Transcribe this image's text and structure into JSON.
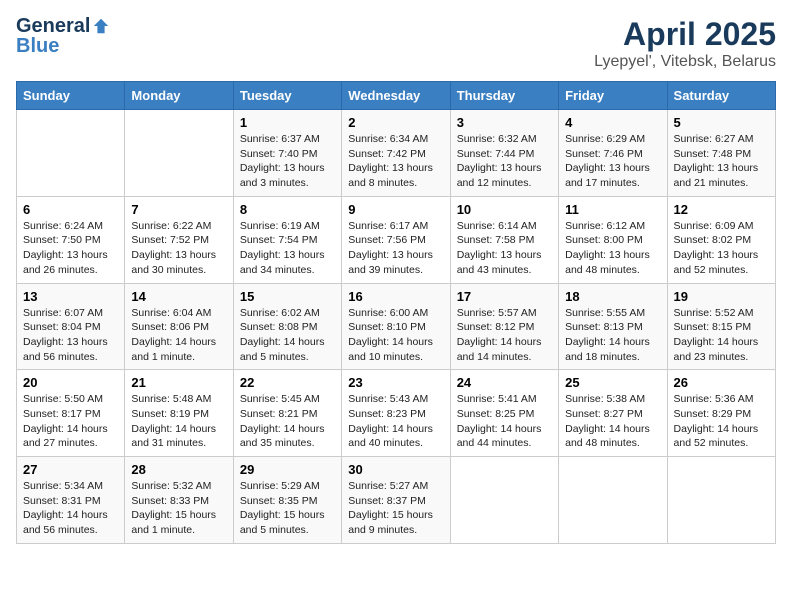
{
  "logo": {
    "general": "General",
    "blue": "Blue"
  },
  "title": "April 2025",
  "location": "Lyepyel', Vitebsk, Belarus",
  "weekdays": [
    "Sunday",
    "Monday",
    "Tuesday",
    "Wednesday",
    "Thursday",
    "Friday",
    "Saturday"
  ],
  "weeks": [
    [
      {
        "day": "",
        "info": ""
      },
      {
        "day": "",
        "info": ""
      },
      {
        "day": "1",
        "info": "Sunrise: 6:37 AM\nSunset: 7:40 PM\nDaylight: 13 hours and 3 minutes."
      },
      {
        "day": "2",
        "info": "Sunrise: 6:34 AM\nSunset: 7:42 PM\nDaylight: 13 hours and 8 minutes."
      },
      {
        "day": "3",
        "info": "Sunrise: 6:32 AM\nSunset: 7:44 PM\nDaylight: 13 hours and 12 minutes."
      },
      {
        "day": "4",
        "info": "Sunrise: 6:29 AM\nSunset: 7:46 PM\nDaylight: 13 hours and 17 minutes."
      },
      {
        "day": "5",
        "info": "Sunrise: 6:27 AM\nSunset: 7:48 PM\nDaylight: 13 hours and 21 minutes."
      }
    ],
    [
      {
        "day": "6",
        "info": "Sunrise: 6:24 AM\nSunset: 7:50 PM\nDaylight: 13 hours and 26 minutes."
      },
      {
        "day": "7",
        "info": "Sunrise: 6:22 AM\nSunset: 7:52 PM\nDaylight: 13 hours and 30 minutes."
      },
      {
        "day": "8",
        "info": "Sunrise: 6:19 AM\nSunset: 7:54 PM\nDaylight: 13 hours and 34 minutes."
      },
      {
        "day": "9",
        "info": "Sunrise: 6:17 AM\nSunset: 7:56 PM\nDaylight: 13 hours and 39 minutes."
      },
      {
        "day": "10",
        "info": "Sunrise: 6:14 AM\nSunset: 7:58 PM\nDaylight: 13 hours and 43 minutes."
      },
      {
        "day": "11",
        "info": "Sunrise: 6:12 AM\nSunset: 8:00 PM\nDaylight: 13 hours and 48 minutes."
      },
      {
        "day": "12",
        "info": "Sunrise: 6:09 AM\nSunset: 8:02 PM\nDaylight: 13 hours and 52 minutes."
      }
    ],
    [
      {
        "day": "13",
        "info": "Sunrise: 6:07 AM\nSunset: 8:04 PM\nDaylight: 13 hours and 56 minutes."
      },
      {
        "day": "14",
        "info": "Sunrise: 6:04 AM\nSunset: 8:06 PM\nDaylight: 14 hours and 1 minute."
      },
      {
        "day": "15",
        "info": "Sunrise: 6:02 AM\nSunset: 8:08 PM\nDaylight: 14 hours and 5 minutes."
      },
      {
        "day": "16",
        "info": "Sunrise: 6:00 AM\nSunset: 8:10 PM\nDaylight: 14 hours and 10 minutes."
      },
      {
        "day": "17",
        "info": "Sunrise: 5:57 AM\nSunset: 8:12 PM\nDaylight: 14 hours and 14 minutes."
      },
      {
        "day": "18",
        "info": "Sunrise: 5:55 AM\nSunset: 8:13 PM\nDaylight: 14 hours and 18 minutes."
      },
      {
        "day": "19",
        "info": "Sunrise: 5:52 AM\nSunset: 8:15 PM\nDaylight: 14 hours and 23 minutes."
      }
    ],
    [
      {
        "day": "20",
        "info": "Sunrise: 5:50 AM\nSunset: 8:17 PM\nDaylight: 14 hours and 27 minutes."
      },
      {
        "day": "21",
        "info": "Sunrise: 5:48 AM\nSunset: 8:19 PM\nDaylight: 14 hours and 31 minutes."
      },
      {
        "day": "22",
        "info": "Sunrise: 5:45 AM\nSunset: 8:21 PM\nDaylight: 14 hours and 35 minutes."
      },
      {
        "day": "23",
        "info": "Sunrise: 5:43 AM\nSunset: 8:23 PM\nDaylight: 14 hours and 40 minutes."
      },
      {
        "day": "24",
        "info": "Sunrise: 5:41 AM\nSunset: 8:25 PM\nDaylight: 14 hours and 44 minutes."
      },
      {
        "day": "25",
        "info": "Sunrise: 5:38 AM\nSunset: 8:27 PM\nDaylight: 14 hours and 48 minutes."
      },
      {
        "day": "26",
        "info": "Sunrise: 5:36 AM\nSunset: 8:29 PM\nDaylight: 14 hours and 52 minutes."
      }
    ],
    [
      {
        "day": "27",
        "info": "Sunrise: 5:34 AM\nSunset: 8:31 PM\nDaylight: 14 hours and 56 minutes."
      },
      {
        "day": "28",
        "info": "Sunrise: 5:32 AM\nSunset: 8:33 PM\nDaylight: 15 hours and 1 minute."
      },
      {
        "day": "29",
        "info": "Sunrise: 5:29 AM\nSunset: 8:35 PM\nDaylight: 15 hours and 5 minutes."
      },
      {
        "day": "30",
        "info": "Sunrise: 5:27 AM\nSunset: 8:37 PM\nDaylight: 15 hours and 9 minutes."
      },
      {
        "day": "",
        "info": ""
      },
      {
        "day": "",
        "info": ""
      },
      {
        "day": "",
        "info": ""
      }
    ]
  ]
}
